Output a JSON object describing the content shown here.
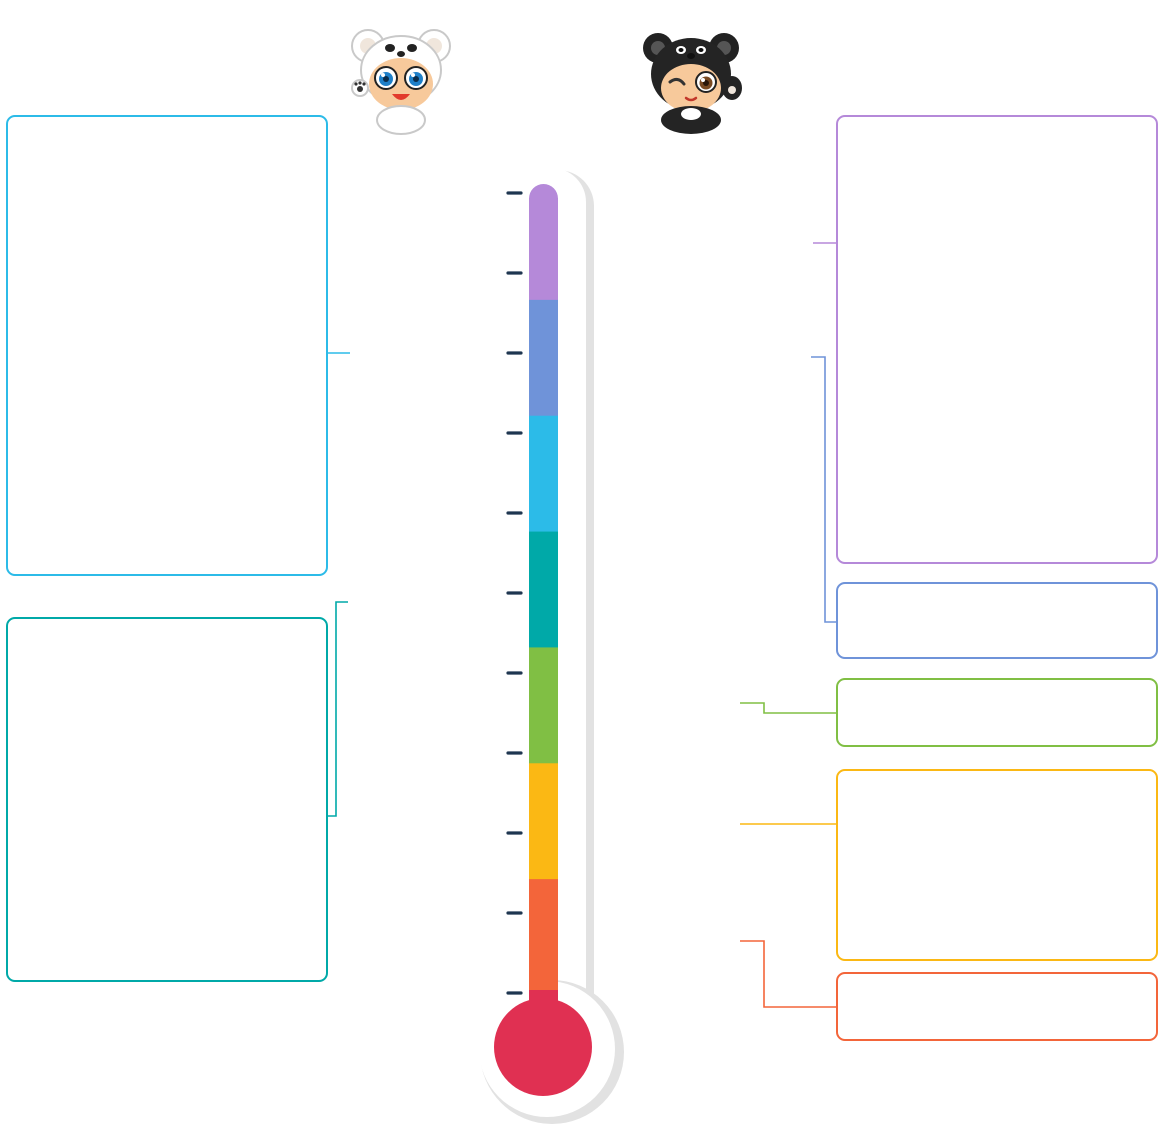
{
  "colors": {
    "band_purple": "#b589d9",
    "band_blue": "#6f93d9",
    "band_sky": "#2cbbe8",
    "band_teal": "#00a9a8",
    "band_green": "#80bf44",
    "band_yellow": "#fbb814",
    "band_orange": "#f3653a",
    "bulb_red": "#e03052",
    "tick_navy": "#1e3650",
    "tube_shadow": "#e2e2e2"
  },
  "diagram": {
    "bands": [
      {
        "id": "band-1",
        "color": "#b589d9"
      },
      {
        "id": "band-2",
        "color": "#6f93d9"
      },
      {
        "id": "band-3",
        "color": "#2cbbe8"
      },
      {
        "id": "band-4",
        "color": "#00a9a8"
      },
      {
        "id": "band-5",
        "color": "#80bf44"
      },
      {
        "id": "band-6",
        "color": "#fbb814"
      },
      {
        "id": "band-7",
        "color": "#f3653a"
      }
    ],
    "tick_count": 11,
    "callouts": [
      {
        "id": "left-top",
        "color": "#2cbbe8",
        "text": ""
      },
      {
        "id": "left-bottom",
        "color": "#00a9a8",
        "text": ""
      },
      {
        "id": "right-1",
        "color": "#b589d9",
        "text": ""
      },
      {
        "id": "right-2",
        "color": "#6f93d9",
        "text": ""
      },
      {
        "id": "right-3",
        "color": "#80bf44",
        "text": ""
      },
      {
        "id": "right-4",
        "color": "#fbb814",
        "text": ""
      },
      {
        "id": "right-5",
        "color": "#f3653a",
        "text": ""
      }
    ],
    "mascots": [
      {
        "id": "white-bear",
        "icon": "white-bear-mascot-icon"
      },
      {
        "id": "black-bear",
        "icon": "black-bear-mascot-icon"
      }
    ]
  }
}
